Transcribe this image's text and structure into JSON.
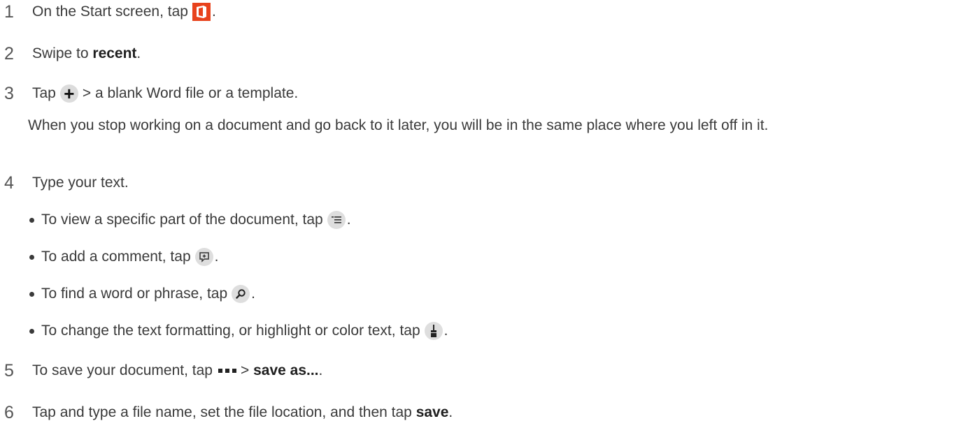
{
  "steps": [
    {
      "num": "1",
      "pre": "On the Start screen, tap",
      "post": "."
    },
    {
      "num": "2",
      "pre": "Swipe to ",
      "bold": "recent",
      "post": "."
    },
    {
      "num": "3",
      "pre": "Tap",
      "post": "> a blank Word file or a template."
    },
    {
      "num": "4",
      "pre": "Type your text."
    },
    {
      "num": "5",
      "pre": "To save your document, tap",
      "mid": "> ",
      "bold": "save as...",
      "post": "."
    },
    {
      "num": "6",
      "pre": "Tap and type a file name, set the file location, and then tap ",
      "bold": "save",
      "post": "."
    }
  ],
  "note": "When you stop working on a document and go back to it later, you will be in the same place where you left off in it.",
  "bullets": [
    {
      "pre": "To view a specific part of the document, tap",
      "post": ".",
      "icon": "outline-icon"
    },
    {
      "pre": "To add a comment, tap",
      "post": ".",
      "icon": "comment-icon"
    },
    {
      "pre": "To find a word or phrase, tap",
      "post": ".",
      "icon": "search-icon"
    },
    {
      "pre": "To change the text formatting, or highlight or color text, tap",
      "post": ".",
      "icon": "brush-icon"
    }
  ],
  "icons": {
    "office_color": "#e8421c"
  }
}
